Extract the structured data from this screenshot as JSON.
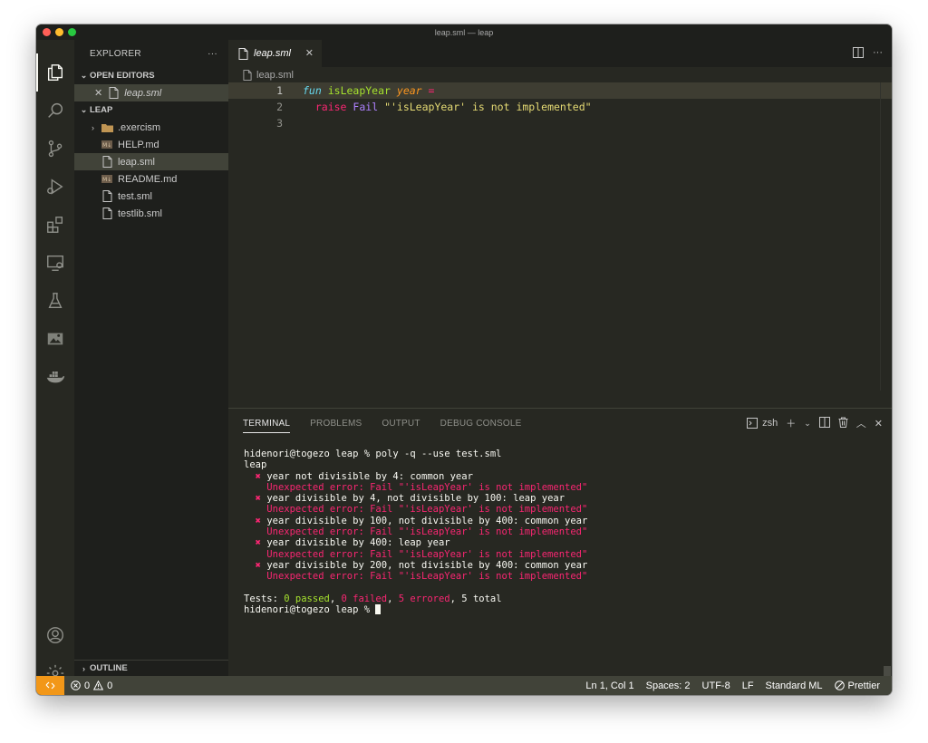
{
  "window": {
    "title": "leap.sml — leap"
  },
  "sidebar": {
    "title": "EXPLORER",
    "more": "···",
    "open_editors": {
      "header": "OPEN EDITORS",
      "items": [
        {
          "label": "leap.sml"
        }
      ]
    },
    "folder": {
      "header": "LEAP",
      "items": [
        {
          "label": ".exercism",
          "icon": "folder-icon"
        },
        {
          "label": "HELP.md",
          "icon": "markdown-icon"
        },
        {
          "label": "leap.sml",
          "icon": "file-icon"
        },
        {
          "label": "README.md",
          "icon": "markdown-icon"
        },
        {
          "label": "test.sml",
          "icon": "file-icon"
        },
        {
          "label": "testlib.sml",
          "icon": "file-icon"
        }
      ]
    },
    "outline": "OUTLINE"
  },
  "editor": {
    "tab_label": "leap.sml",
    "breadcrumb": "leap.sml",
    "lines": [
      {
        "num": "1",
        "tokens": [
          "fun",
          "isLeapYear",
          "year",
          "="
        ]
      },
      {
        "num": "2",
        "tokens": [
          "raise",
          "Fail",
          "\"'isLeapYear' is not implemented\""
        ]
      },
      {
        "num": "3",
        "tokens": []
      }
    ]
  },
  "panel": {
    "tabs": [
      "TERMINAL",
      "PROBLEMS",
      "OUTPUT",
      "DEBUG CONSOLE"
    ],
    "shell": "zsh",
    "terminal": {
      "command_line": "hidenori@togezo leap % poly -q --use test.sml",
      "group": "leap",
      "mark": "✖",
      "tests": [
        {
          "name": "year not divisible by 4: common year",
          "error": "Unexpected error: Fail \"'isLeapYear' is not implemented\""
        },
        {
          "name": "year divisible by 4, not divisible by 100: leap year",
          "error": "Unexpected error: Fail \"'isLeapYear' is not implemented\""
        },
        {
          "name": "year divisible by 100, not divisible by 400: common year",
          "error": "Unexpected error: Fail \"'isLeapYear' is not implemented\""
        },
        {
          "name": "year divisible by 400: leap year",
          "error": "Unexpected error: Fail \"'isLeapYear' is not implemented\""
        },
        {
          "name": "year divisible by 200, not divisible by 400: common year",
          "error": "Unexpected error: Fail \"'isLeapYear' is not implemented\""
        }
      ],
      "summary_prefix": "Tests: ",
      "summary_passed": "0 passed",
      "summary_failed": "0 failed",
      "summary_errored": "5 errored",
      "summary_total": "5 total",
      "prompt": "hidenori@togezo leap % "
    }
  },
  "statusbar": {
    "errors": "0",
    "warnings": "0",
    "position": "Ln 1, Col 1",
    "spaces": "Spaces: 2",
    "encoding": "UTF-8",
    "eol": "LF",
    "language": "Standard ML",
    "formatter": "Prettier"
  }
}
